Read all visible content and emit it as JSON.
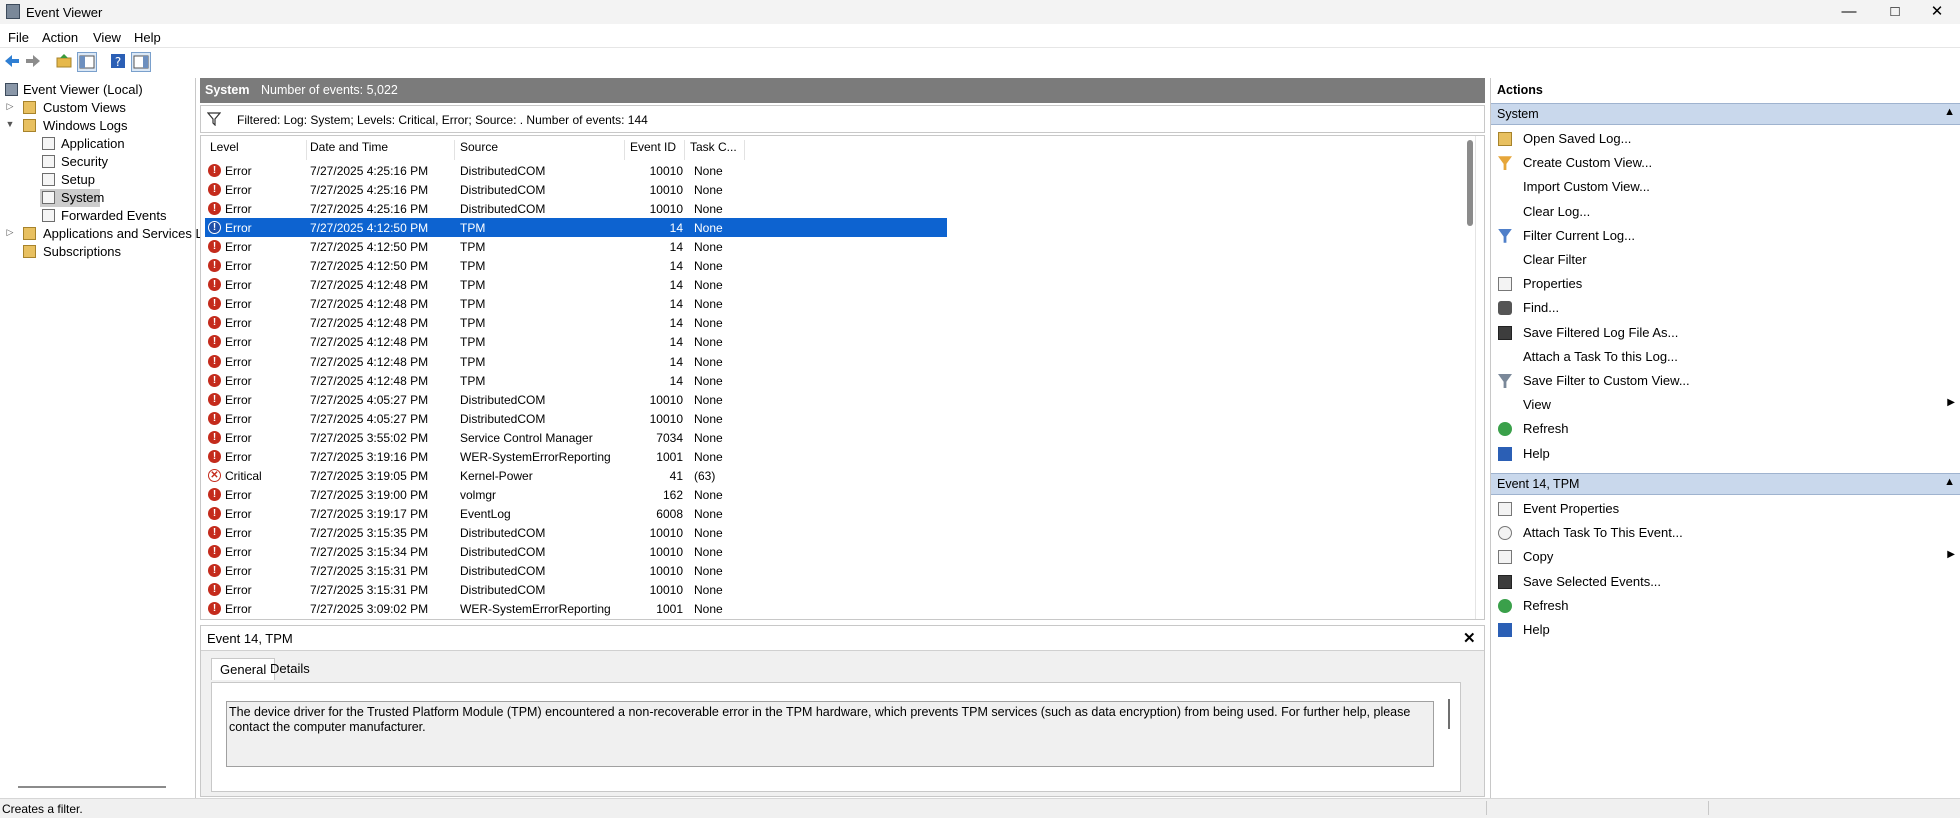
{
  "window": {
    "title": "Event Viewer"
  },
  "menu": [
    "File",
    "Action",
    "View",
    "Help"
  ],
  "tree": {
    "root": "Event Viewer (Local)",
    "custom_views": "Custom Views",
    "windows_logs": "Windows Logs",
    "logs": [
      "Application",
      "Security",
      "Setup",
      "System",
      "Forwarded Events"
    ],
    "apps_services": "Applications and Services Lo",
    "subscriptions": "Subscriptions"
  },
  "center": {
    "log_name": "System",
    "count_text": "Number of events: 5,022",
    "filter_text": "Filtered: Log: System; Levels: Critical, Error; Source: . Number of events: 144",
    "columns": [
      "Level",
      "Date and Time",
      "Source",
      "Event ID",
      "Task C..."
    ],
    "rows": [
      {
        "level": "Error",
        "date": "7/27/2025 4:25:16 PM",
        "source": "DistributedCOM",
        "id": "10010",
        "task": "None"
      },
      {
        "level": "Error",
        "date": "7/27/2025 4:25:16 PM",
        "source": "DistributedCOM",
        "id": "10010",
        "task": "None"
      },
      {
        "level": "Error",
        "date": "7/27/2025 4:25:16 PM",
        "source": "DistributedCOM",
        "id": "10010",
        "task": "None"
      },
      {
        "level": "Error",
        "date": "7/27/2025 4:12:50 PM",
        "source": "TPM",
        "id": "14",
        "task": "None"
      },
      {
        "level": "Error",
        "date": "7/27/2025 4:12:50 PM",
        "source": "TPM",
        "id": "14",
        "task": "None"
      },
      {
        "level": "Error",
        "date": "7/27/2025 4:12:50 PM",
        "source": "TPM",
        "id": "14",
        "task": "None"
      },
      {
        "level": "Error",
        "date": "7/27/2025 4:12:48 PM",
        "source": "TPM",
        "id": "14",
        "task": "None"
      },
      {
        "level": "Error",
        "date": "7/27/2025 4:12:48 PM",
        "source": "TPM",
        "id": "14",
        "task": "None"
      },
      {
        "level": "Error",
        "date": "7/27/2025 4:12:48 PM",
        "source": "TPM",
        "id": "14",
        "task": "None"
      },
      {
        "level": "Error",
        "date": "7/27/2025 4:12:48 PM",
        "source": "TPM",
        "id": "14",
        "task": "None"
      },
      {
        "level": "Error",
        "date": "7/27/2025 4:12:48 PM",
        "source": "TPM",
        "id": "14",
        "task": "None"
      },
      {
        "level": "Error",
        "date": "7/27/2025 4:12:48 PM",
        "source": "TPM",
        "id": "14",
        "task": "None"
      },
      {
        "level": "Error",
        "date": "7/27/2025 4:05:27 PM",
        "source": "DistributedCOM",
        "id": "10010",
        "task": "None"
      },
      {
        "level": "Error",
        "date": "7/27/2025 4:05:27 PM",
        "source": "DistributedCOM",
        "id": "10010",
        "task": "None"
      },
      {
        "level": "Error",
        "date": "7/27/2025 3:55:02 PM",
        "source": "Service Control Manager",
        "id": "7034",
        "task": "None"
      },
      {
        "level": "Error",
        "date": "7/27/2025 3:19:16 PM",
        "source": "WER-SystemErrorReporting",
        "id": "1001",
        "task": "None"
      },
      {
        "level": "Critical",
        "date": "7/27/2025 3:19:05 PM",
        "source": "Kernel-Power",
        "id": "41",
        "task": "(63)"
      },
      {
        "level": "Error",
        "date": "7/27/2025 3:19:00 PM",
        "source": "volmgr",
        "id": "162",
        "task": "None"
      },
      {
        "level": "Error",
        "date": "7/27/2025 3:19:17 PM",
        "source": "EventLog",
        "id": "6008",
        "task": "None"
      },
      {
        "level": "Error",
        "date": "7/27/2025 3:15:35 PM",
        "source": "DistributedCOM",
        "id": "10010",
        "task": "None"
      },
      {
        "level": "Error",
        "date": "7/27/2025 3:15:34 PM",
        "source": "DistributedCOM",
        "id": "10010",
        "task": "None"
      },
      {
        "level": "Error",
        "date": "7/27/2025 3:15:31 PM",
        "source": "DistributedCOM",
        "id": "10010",
        "task": "None"
      },
      {
        "level": "Error",
        "date": "7/27/2025 3:15:31 PM",
        "source": "DistributedCOM",
        "id": "10010",
        "task": "None"
      },
      {
        "level": "Error",
        "date": "7/27/2025 3:09:02 PM",
        "source": "WER-SystemErrorReporting",
        "id": "1001",
        "task": "None"
      }
    ],
    "selected_row": 3
  },
  "detail": {
    "title": "Event 14, TPM",
    "tabs": [
      "General",
      "Details"
    ],
    "description": "The device driver for the Trusted Platform Module (TPM) encountered a non-recoverable error in the TPM hardware, which prevents TPM services (such as data encryption) from being used. For further help, please contact the computer manufacturer."
  },
  "actions": {
    "header": "Actions",
    "section1": "System",
    "section1_items": [
      "Open Saved Log...",
      "Create Custom View...",
      "Import Custom View...",
      "Clear Log...",
      "Filter Current Log...",
      "Clear Filter",
      "Properties",
      "Find...",
      "Save Filtered Log File As...",
      "Attach a Task To this Log...",
      "Save Filter to Custom View...",
      "View",
      "Refresh",
      "Help"
    ],
    "section2": "Event 14, TPM",
    "section2_items": [
      "Event Properties",
      "Attach Task To This Event...",
      "Copy",
      "Save Selected Events...",
      "Refresh",
      "Help"
    ]
  },
  "status": "Creates a filter.",
  "colors": {
    "selection": "#0d63d0",
    "error": "#c42b1c",
    "header_bar": "#7b7b7b",
    "action_section": "#c9d8ec"
  }
}
